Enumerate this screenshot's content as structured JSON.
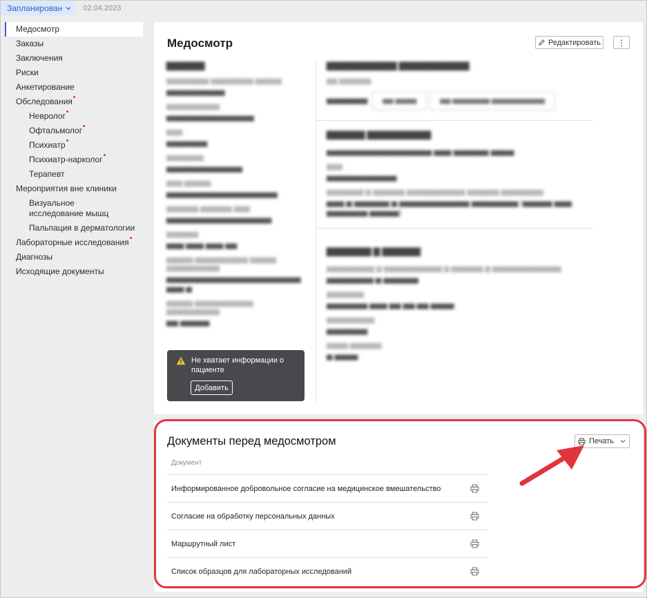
{
  "topbar": {
    "status": "Запланирован",
    "date": "02.04.2023"
  },
  "sidebar": {
    "items": [
      {
        "label": "Медосмотр"
      },
      {
        "label": "Заказы"
      },
      {
        "label": "Заключения"
      },
      {
        "label": "Риски"
      },
      {
        "label": "Анкетирование"
      },
      {
        "label": "Обследования"
      },
      {
        "label": "Невролог"
      },
      {
        "label": "Офтальмолог"
      },
      {
        "label": "Психиатр"
      },
      {
        "label": "Психиатр-нарколог"
      },
      {
        "label": "Терапевт"
      },
      {
        "label": "Мероприятия вне клиники"
      },
      {
        "label": "Визуальное исследование мышц"
      },
      {
        "label": "Пальпация в дерматологии"
      },
      {
        "label": "Лабораторные исследования"
      },
      {
        "label": "Диагнозы"
      },
      {
        "label": "Исходящие документы"
      }
    ]
  },
  "main": {
    "title": "Медосмотр",
    "edit_label": "Редактировать",
    "more_label": "⋮",
    "warning": {
      "text": "Не хватает информации о пациенте",
      "button": "Добавить"
    }
  },
  "docs": {
    "title": "Документы перед медосмотром",
    "print_label": "Печать",
    "column_header": "Документ",
    "rows": [
      "Информированное добровольное согласие на медицинское вмешательство",
      "Согласие на обработку персональных данных",
      "Маршрутный лист",
      "Список образцов для лабораторных исследований"
    ]
  },
  "colors": {
    "accent": "#2f5fd0",
    "highlight": "#e0353c",
    "badge_dot": "#e2332e"
  }
}
